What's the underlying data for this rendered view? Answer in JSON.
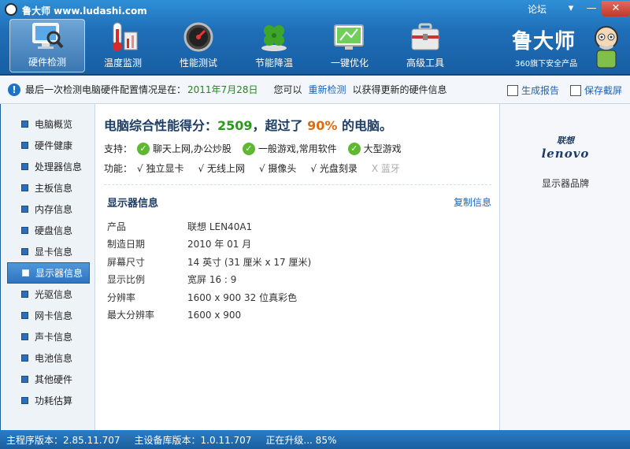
{
  "window": {
    "title": "鲁大师 www.ludashi.com",
    "forum": "论坛",
    "min_symbol": "▾",
    "max_symbol": "—",
    "close_symbol": "✕"
  },
  "toolbar": {
    "items": [
      {
        "label": "硬件检测",
        "icon": "monitor-magnifier-icon"
      },
      {
        "label": "温度监测",
        "icon": "thermometer-icon"
      },
      {
        "label": "性能测试",
        "icon": "speedometer-icon"
      },
      {
        "label": "节能降温",
        "icon": "clover-icon"
      },
      {
        "label": "一键优化",
        "icon": "optimize-screen-icon"
      },
      {
        "label": "高级工具",
        "icon": "toolbox-icon"
      }
    ],
    "active_index": 0
  },
  "brand": {
    "name": "鲁大师",
    "subtitle": "360旗下安全产品"
  },
  "infobar": {
    "prefix": "最后一次检测电脑硬件配置情况是在：",
    "date": "2011年7月28日",
    "mid": "您可以",
    "recheck": "重新检测",
    "suffix": "以获得更新的硬件信息",
    "report": "生成报告",
    "screenshot": "保存截屏"
  },
  "sidebar": {
    "items": [
      "电脑概览",
      "硬件健康",
      "处理器信息",
      "主板信息",
      "内存信息",
      "硬盘信息",
      "显卡信息",
      "显示器信息",
      "光驱信息",
      "网卡信息",
      "声卡信息",
      "电池信息",
      "其他硬件",
      "功耗估算"
    ],
    "active_index": 7
  },
  "summary": {
    "score_prefix": "电脑综合性能得分：",
    "score": "2509",
    "score_mid": "，超过了",
    "percent": "90%",
    "score_suffix": "的电脑。",
    "support_label": "支持：",
    "support": [
      "聊天上网,办公炒股",
      "一般游戏,常用软件",
      "大型游戏"
    ],
    "func_label": "功能：",
    "functions": [
      {
        "text": "√ 独立显卡",
        "enabled": true
      },
      {
        "text": "√ 无线上网",
        "enabled": true
      },
      {
        "text": "√ 摄像头",
        "enabled": true
      },
      {
        "text": "√ 光盘刻录",
        "enabled": true
      },
      {
        "text": "X 蓝牙",
        "enabled": false
      }
    ]
  },
  "monitor": {
    "title": "显示器信息",
    "copy": "复制信息",
    "rows": [
      {
        "k": "产品",
        "v": "联想 LEN40A1"
      },
      {
        "k": "制造日期",
        "v": "2010 年 01 月"
      },
      {
        "k": "屏幕尺寸",
        "v": "14 英寸 (31 厘米 x 17 厘米)"
      },
      {
        "k": "显示比例",
        "v": "宽屏 16 : 9"
      },
      {
        "k": "分辨率",
        "v": "1600 x 900 32 位真彩色"
      },
      {
        "k": "最大分辨率",
        "v": "1600 x 900"
      }
    ]
  },
  "rightpanel": {
    "logo_cn": "联想",
    "logo_en": "lenovo",
    "caption": "显示器品牌"
  },
  "status": {
    "main_version": "主程序版本：2.85.11.707",
    "db_version": "主设备库版本：1.0.11.707",
    "upgrading": "正在升级... 85%"
  },
  "colors": {
    "header": "#1f6fb8",
    "score": "#2a9a1a",
    "percent": "#e06a10",
    "link": "#1a63b8"
  }
}
